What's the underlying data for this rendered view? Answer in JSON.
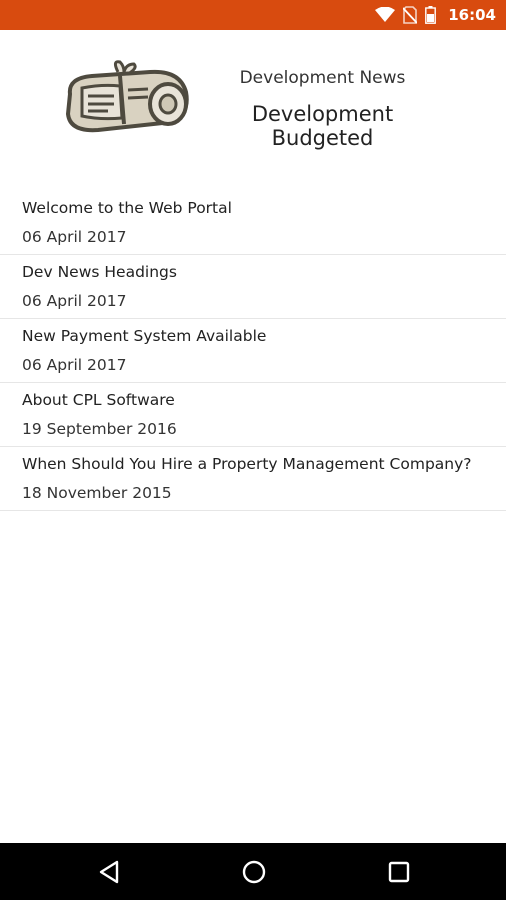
{
  "status_bar": {
    "time": "16:04",
    "icons": [
      "wifi-icon",
      "no-sim-icon",
      "battery-icon"
    ],
    "background": "#d84b0f"
  },
  "header": {
    "subtitle": "Development News",
    "title": "Development Budgeted",
    "logo_icon": "newspaper-icon"
  },
  "news": [
    {
      "title": "Welcome to the Web Portal",
      "date": "06 April 2017"
    },
    {
      "title": "Dev News Headings",
      "date": "06 April 2017"
    },
    {
      "title": "New Payment System Available",
      "date": "06 April 2017"
    },
    {
      "title": "About CPL Software",
      "date": "19 September 2016"
    },
    {
      "title": "When Should You Hire a Property Management Company?",
      "date": "18 November 2015"
    }
  ],
  "nav_bar": {
    "buttons": [
      "back-icon",
      "home-icon",
      "recents-icon"
    ]
  }
}
